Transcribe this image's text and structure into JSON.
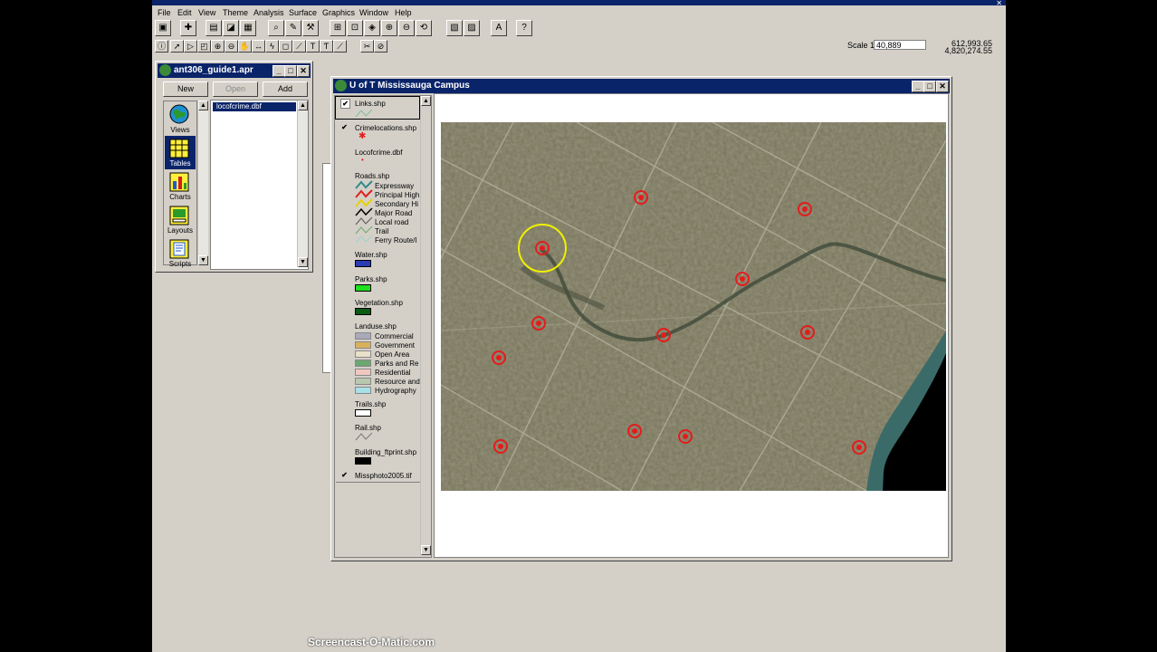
{
  "menu": {
    "file": "File",
    "edit": "Edit",
    "view": "View",
    "theme": "Theme",
    "analysis": "Analysis",
    "surface": "Surface",
    "graphics": "Graphics",
    "window": "Window",
    "help": "Help"
  },
  "scale": {
    "label": "Scale 1:",
    "value": "40,889"
  },
  "coords": {
    "x": "612,993.65",
    "y": "4,820,274.55"
  },
  "project": {
    "title": "ant306_guide1.apr",
    "buttons": {
      "new": "New",
      "open": "Open",
      "add": "Add"
    },
    "doc_types": [
      {
        "label": "Views",
        "icon": "globe-icon"
      },
      {
        "label": "Tables",
        "icon": "table-icon"
      },
      {
        "label": "Charts",
        "icon": "chart-icon"
      },
      {
        "label": "Layouts",
        "icon": "layout-icon"
      },
      {
        "label": "Scripts",
        "icon": "script-icon"
      }
    ],
    "selected_type": "Tables",
    "list": [
      "locofcrime.dbf"
    ]
  },
  "view": {
    "title": "U of T Mississauga Campus",
    "layers": [
      {
        "name": "Links.shp",
        "checked": true
      },
      {
        "name": "Crimelocations.shp",
        "checked": true
      },
      {
        "name": "Locofcrime.dbf",
        "checked": false
      },
      {
        "name": "Roads.shp",
        "checked": false,
        "classes": [
          "Expressway",
          "Principal High",
          "Secondary Hi",
          "Major Road",
          "Local road",
          "Trail",
          "Ferry Route/l"
        ]
      },
      {
        "name": "Water.shp",
        "checked": false
      },
      {
        "name": "Parks.shp",
        "checked": false
      },
      {
        "name": "Vegetation.shp",
        "checked": false
      },
      {
        "name": "Landuse.shp",
        "checked": false,
        "classes": [
          "Commercial",
          "Government",
          "Open Area",
          "Parks and Re",
          "Residential",
          "Resource and",
          "Hydrography"
        ]
      },
      {
        "name": "Trails.shp",
        "checked": false
      },
      {
        "name": "Rail.shp",
        "checked": false
      },
      {
        "name": "Building_ftprint.shp",
        "checked": false
      },
      {
        "name": "Missphoto2005.tif",
        "checked": true
      }
    ],
    "colors": {
      "water": "#2b3bb5",
      "parks": "#1fe01f",
      "vegetation": "#0b5a12",
      "building": "#000000",
      "crime": "#e51b1b"
    }
  },
  "watermark": "Screencast-O-Matic.com"
}
